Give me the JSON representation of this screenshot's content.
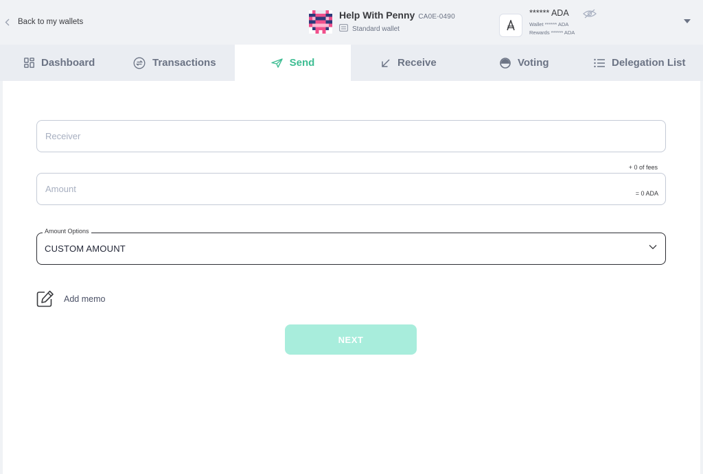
{
  "header": {
    "back_label": "Back to my wallets",
    "wallet_name": "Help With Penny",
    "wallet_checksum": "CA0E-0490",
    "wallet_type": "Standard wallet",
    "balance_main": "****** ADA",
    "balance_wallet": "Wallet ****** ADA",
    "balance_rewards": "Rewards ****** ADA"
  },
  "tabs": [
    {
      "label": "Dashboard",
      "icon": "dashboard-icon"
    },
    {
      "label": "Transactions",
      "icon": "transactions-icon"
    },
    {
      "label": "Send",
      "icon": "send-icon",
      "active": true
    },
    {
      "label": "Receive",
      "icon": "receive-icon"
    },
    {
      "label": "Voting",
      "icon": "voting-icon"
    },
    {
      "label": "Delegation List",
      "icon": "list-icon"
    }
  ],
  "form": {
    "receiver_placeholder": "Receiver",
    "amount_placeholder": "Amount",
    "fees_label": "+ 0 of fees",
    "amount_ada": "= 0 ADA",
    "amount_options_label": "Amount Options",
    "amount_options_value": "CUSTOM AMOUNT",
    "add_memo_label": "Add memo",
    "next_label": "NEXT"
  },
  "colors": {
    "accent": "#3ebd93",
    "next_disabled": "#a8eddc",
    "text": "#38393d",
    "muted": "#6b7384"
  }
}
